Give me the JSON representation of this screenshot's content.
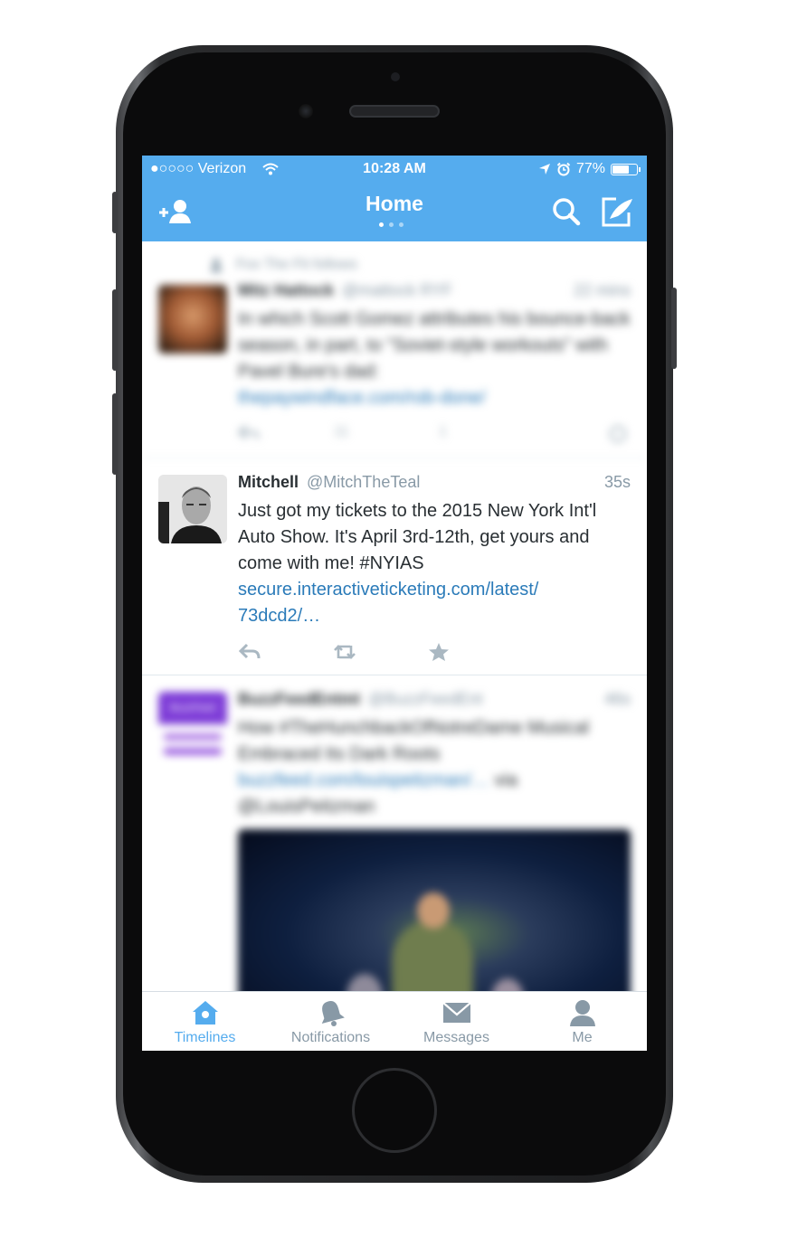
{
  "colors": {
    "brand": "#55acee",
    "link": "#2b7bb9",
    "text": "#292f33",
    "secondary": "#8899a6"
  },
  "status_bar": {
    "carrier": "●○○○○ Verizon",
    "time": "10:28 AM",
    "battery_percent_label": "77%",
    "battery_level": 0.77
  },
  "nav": {
    "title": "Home",
    "page_count": 3,
    "active_page": 1,
    "icons": {
      "left": "add-user-icon",
      "search": "search-icon",
      "compose": "compose-icon"
    }
  },
  "timeline": {
    "tweets": [
      {
        "blurred": true,
        "context": "Fox The Fit follows",
        "name": "Mitz Hattock",
        "handle": "@mattock RYF",
        "time": "22 mins",
        "text": "In which Scott Gomez attributes his bounce-back season, in part, to \"Soviet-style workouts\" with Pavel Bure's dad:",
        "link": "thepaywindface.com/rob-done/",
        "actions": {
          "reply": "",
          "retweet": "11",
          "favorite": "1"
        }
      },
      {
        "blurred": false,
        "name": "Mitchell",
        "handle": "@MitchTheTeal",
        "time": "35s",
        "text": "Just got my tickets to the 2015 New York Int'l Auto Show. It's April 3rd-12th, get yours and come with me! #NYIAS",
        "link_line1": "secure.interactiveticketing.com/latest/",
        "link_line2": "73dcd2/…"
      },
      {
        "blurred": true,
        "name": "BuzzFeedEntmt",
        "handle": "@BuzzFeedEnt",
        "time": "46s",
        "text": "How #TheHunchbackOfNotreDame Musical Embraced Its Dark Roots",
        "link": "buzzfeed.com/louispeitzman/…",
        "link_suffix": "via",
        "text_tail": "@LouisPeitzman",
        "avatar_label": "BuzzFeed"
      }
    ]
  },
  "tab_bar": {
    "tabs": [
      {
        "label": "Timelines",
        "icon": "home-icon",
        "active": true
      },
      {
        "label": "Notifications",
        "icon": "bell-icon",
        "active": false
      },
      {
        "label": "Messages",
        "icon": "envelope-icon",
        "active": false
      },
      {
        "label": "Me",
        "icon": "person-icon",
        "active": false
      }
    ]
  }
}
